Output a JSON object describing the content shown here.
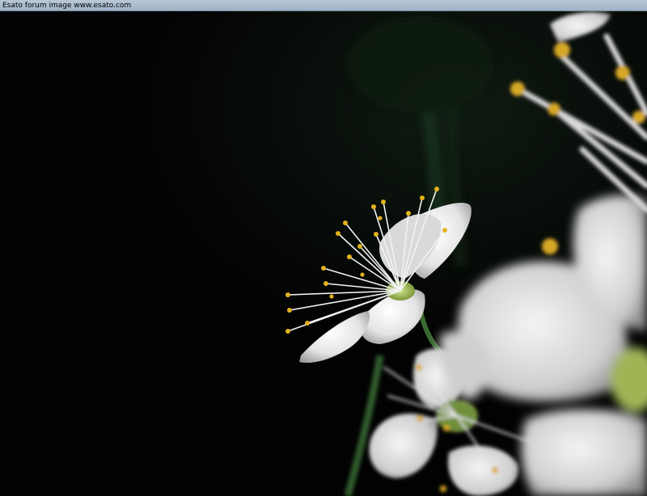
{
  "header": {
    "caption": "Esato forum image www.esato.com"
  },
  "colors": {
    "background": "#020202",
    "petal": "#ececec",
    "anther": "#e0b020",
    "stem": "#2f5a2a",
    "header_bar": "#a9bbcf"
  },
  "photo": {
    "subject": ""
  }
}
